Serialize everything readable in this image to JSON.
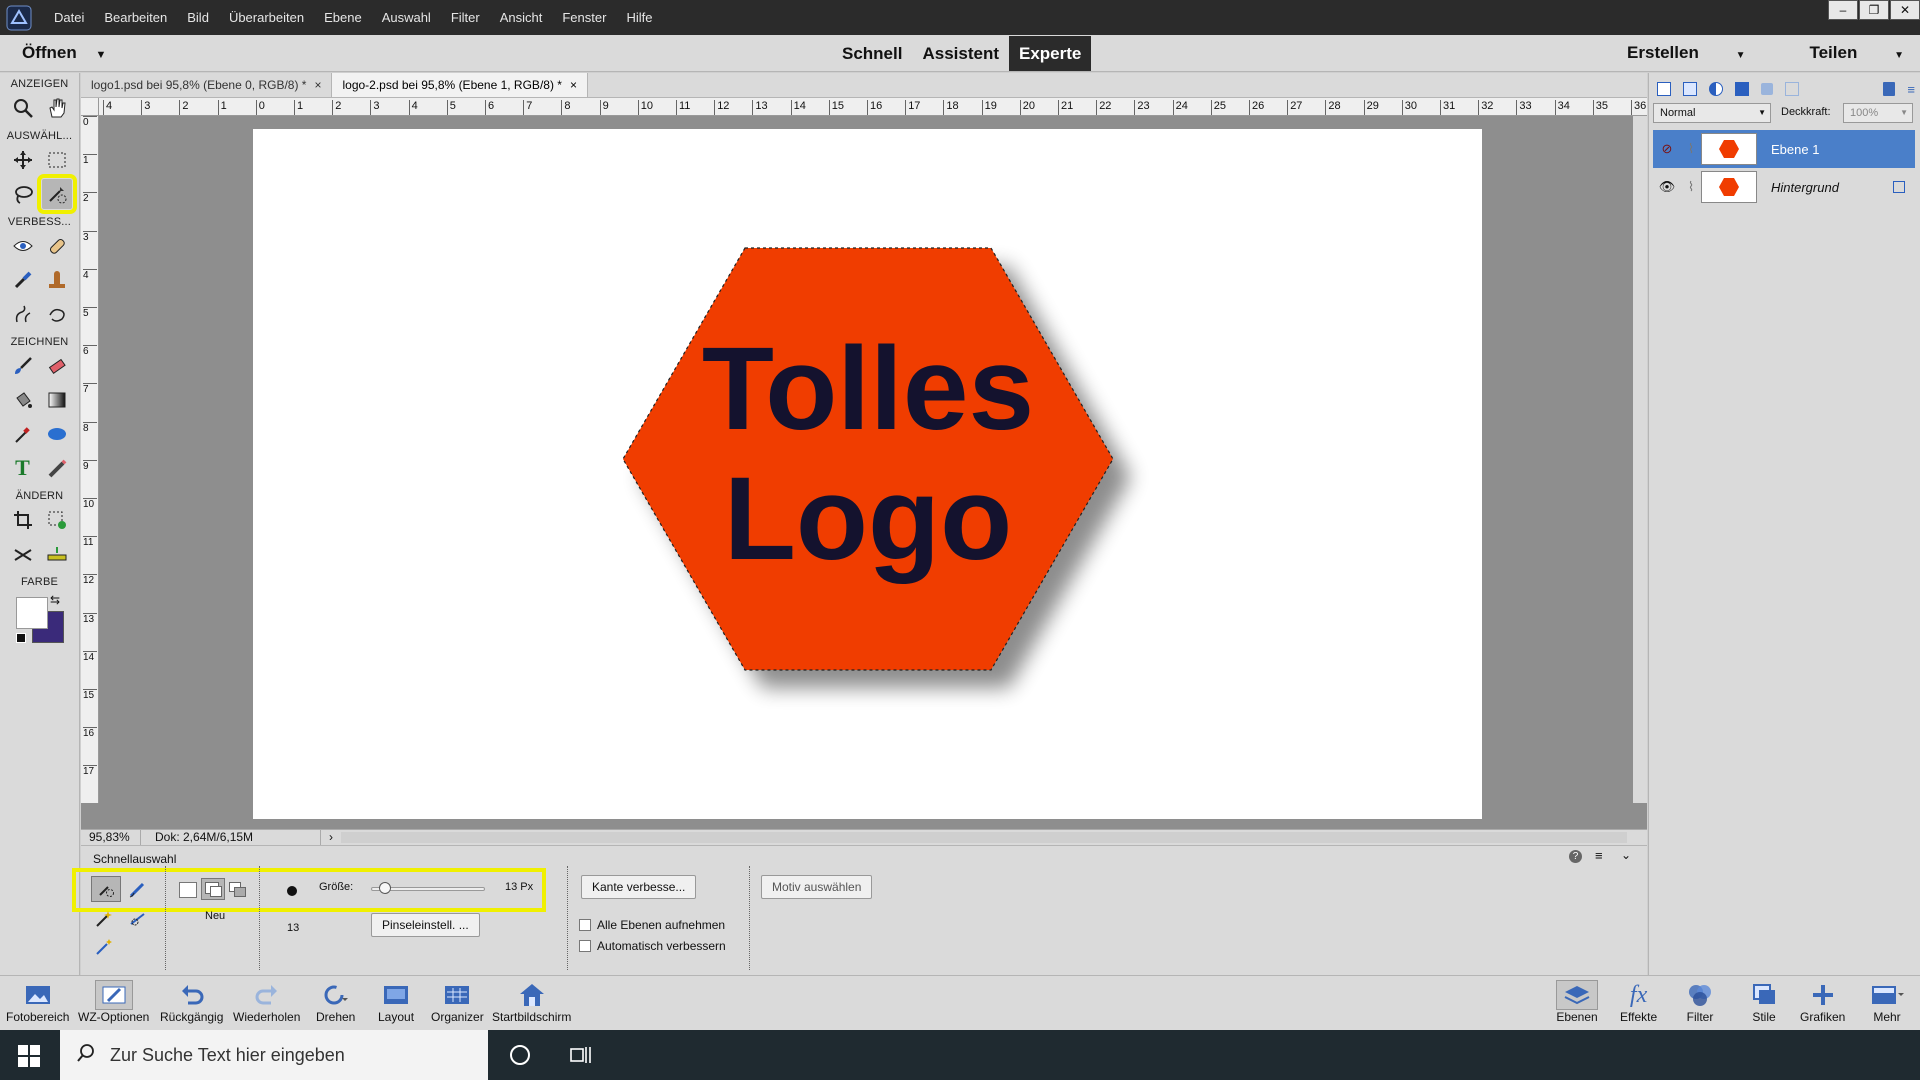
{
  "menubar": {
    "items": [
      "Datei",
      "Bearbeiten",
      "Bild",
      "Überarbeiten",
      "Ebene",
      "Auswahl",
      "Filter",
      "Ansicht",
      "Fenster",
      "Hilfe"
    ],
    "window_buttons": [
      "–",
      "❐",
      "✕"
    ]
  },
  "modebar": {
    "open_label": "Öffnen",
    "modes": [
      "Schnell",
      "Assistent",
      "Experte"
    ],
    "active_mode": "Experte",
    "create_label": "Erstellen",
    "share_label": "Teilen"
  },
  "toolbox": {
    "sections": [
      "ANZEIGEN",
      "AUSWÄHL...",
      "VERBESS...",
      "ZEICHNEN",
      "ÄNDERN",
      "FARBE"
    ],
    "foreground_color": "#ffffff",
    "background_color": "#3a2a7a"
  },
  "tabs": [
    {
      "label": "logo1.psd bei 95,8% (Ebene 0, RGB/8) *",
      "close": "×"
    },
    {
      "label": "logo-2.psd bei 95,8% (Ebene 1, RGB/8) *",
      "close": "×"
    }
  ],
  "ruler": {
    "h_ticks": [
      "4",
      "3",
      "2",
      "1",
      "0",
      "1",
      "2",
      "3",
      "4",
      "5",
      "6",
      "7",
      "8",
      "9",
      "10",
      "11",
      "12",
      "13",
      "14",
      "15",
      "16",
      "17",
      "18",
      "19",
      "20",
      "21",
      "22",
      "23",
      "24",
      "25",
      "26",
      "27",
      "28",
      "29",
      "30",
      "31",
      "32",
      "33",
      "34",
      "35",
      "36"
    ],
    "v_ticks": [
      "0",
      "1",
      "2",
      "3",
      "4",
      "5",
      "6",
      "7",
      "8",
      "9",
      "10",
      "11",
      "12",
      "13",
      "14",
      "15",
      "16",
      "17"
    ]
  },
  "artwork": {
    "line1": "Tolles",
    "line2": "Logo",
    "hex_color": "#f03c00",
    "text_color": "#14122e"
  },
  "status": {
    "zoom": "95,83%",
    "doc": "Dok: 2,64M/6,15M"
  },
  "options": {
    "title": "Schnellauswahl",
    "mode_label": "Neu",
    "size_label": "Größe:",
    "size_value": "13 Px",
    "brush_size": "13",
    "brush_settings_button": "Pinseleinstell. ...",
    "refine_edge_button": "Kante verbesse...",
    "select_subject_button": "Motiv auswählen",
    "sample_all_layers": "Alle Ebenen aufnehmen",
    "auto_enhance": "Automatisch verbessern",
    "size_fraction": 0.05
  },
  "layers_panel": {
    "blend_mode": "Normal",
    "opacity_label": "Deckkraft:",
    "opacity_value": "100%",
    "layers": [
      {
        "name": "Ebene 1",
        "active": true
      },
      {
        "name": "Hintergrund",
        "active": false
      }
    ]
  },
  "bottombar": {
    "left": [
      "Fotobereich",
      "WZ-Optionen",
      "Rückgängig",
      "Wiederholen",
      "Drehen",
      "Layout",
      "Organizer",
      "Startbildschirm"
    ],
    "right": [
      "Ebenen",
      "Effekte",
      "Filter",
      "Stile",
      "Grafiken",
      "Mehr"
    ]
  },
  "taskbar": {
    "search_placeholder": "Zur Suche Text hier eingeben"
  }
}
